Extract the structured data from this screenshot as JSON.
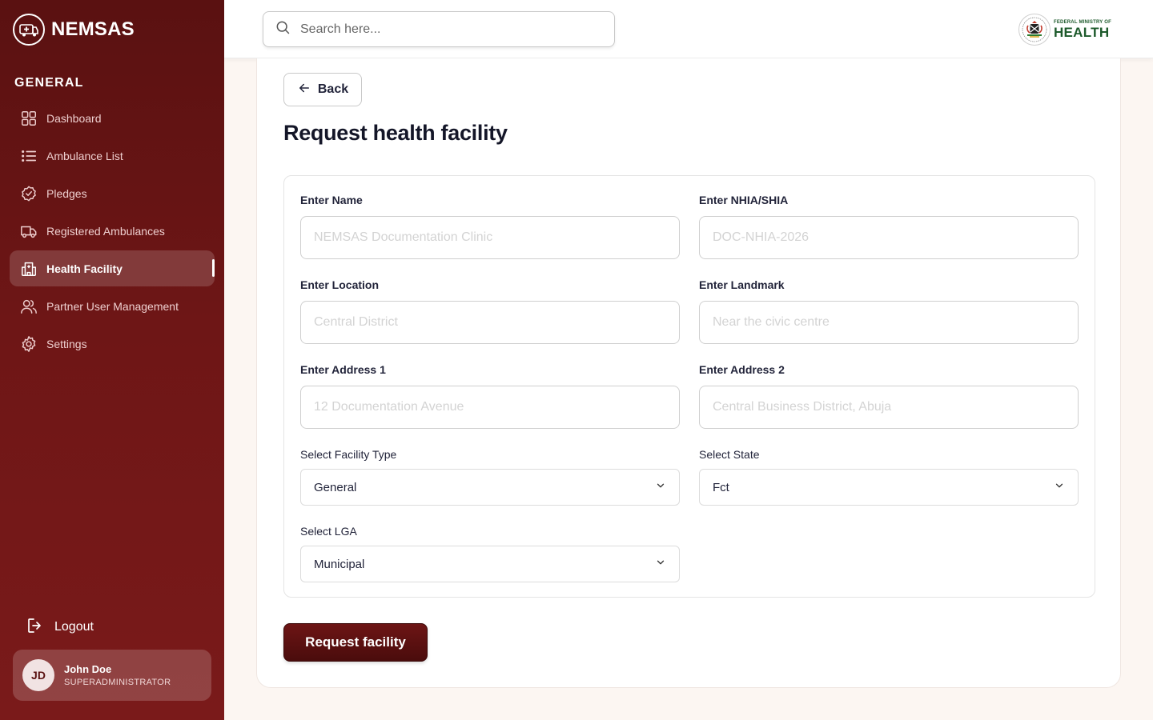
{
  "brand": {
    "name": "NEMSAS"
  },
  "sidebar": {
    "section_label": "GENERAL",
    "items": [
      {
        "label": "Dashboard",
        "icon": "dashboard-grid-icon",
        "active": false
      },
      {
        "label": "Ambulance List",
        "icon": "list-icon",
        "active": false
      },
      {
        "label": "Pledges",
        "icon": "badge-check-icon",
        "active": false
      },
      {
        "label": "Registered Ambulances",
        "icon": "truck-icon",
        "active": false
      },
      {
        "label": "Health Facility",
        "icon": "hospital-icon",
        "active": true
      },
      {
        "label": "Partner User Management",
        "icon": "users-icon",
        "active": false
      },
      {
        "label": "Settings",
        "icon": "gear-icon",
        "active": false
      }
    ],
    "logout_label": "Logout",
    "user": {
      "initials": "JD",
      "name": "John Doe",
      "role": "SUPERADMINISTRATOR"
    }
  },
  "topbar": {
    "search_placeholder": "Search here...",
    "ministry_small": "FEDERAL MINISTRY OF",
    "ministry_big": "HEALTH"
  },
  "page": {
    "back_label": "Back",
    "title": "Request health facility",
    "submit_label": "Request facility"
  },
  "form": {
    "name": {
      "label": "Enter Name",
      "placeholder": "NEMSAS Documentation Clinic"
    },
    "nhia": {
      "label": "Enter NHIA/SHIA",
      "placeholder": "DOC-NHIA-2026"
    },
    "location": {
      "label": "Enter Location",
      "placeholder": "Central District"
    },
    "landmark": {
      "label": "Enter Landmark",
      "placeholder": "Near the civic centre"
    },
    "address1": {
      "label": "Enter Address 1",
      "placeholder": "12 Documentation Avenue"
    },
    "address2": {
      "label": "Enter Address 2",
      "placeholder": "Central Business District, Abuja"
    },
    "facility_type": {
      "label": "Select Facility Type",
      "value": "General"
    },
    "state": {
      "label": "Select State",
      "value": "Fct"
    },
    "lga": {
      "label": "Select LGA",
      "value": "Municipal"
    }
  },
  "colors": {
    "sidebar_dark": "#5a1111",
    "sidebar_light": "#7a1a1a",
    "accent_green": "#1d5a2b",
    "background": "#fcf6f2"
  }
}
